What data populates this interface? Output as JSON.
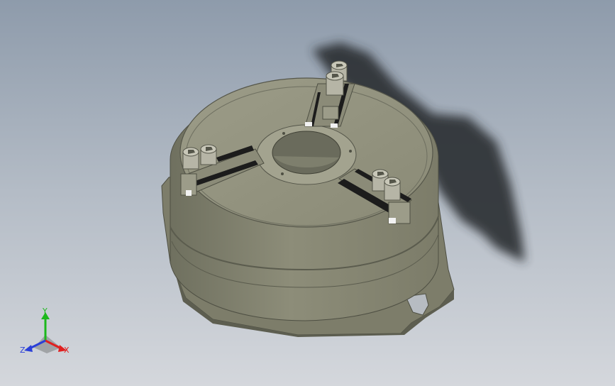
{
  "viewport": {
    "model": "chuck-assembly",
    "colors": {
      "background_top": "#8e9bab",
      "background_bottom": "#d4d7dc",
      "body": "#8c8c78",
      "body_dark": "#6f705f",
      "body_light": "#a3a38f",
      "shadow": "#2b2d30",
      "jaw_slot": "#1c1c1c",
      "bolt": "#b6b5a6"
    }
  },
  "triad": {
    "y_label": "Y",
    "x_label": "X",
    "z_label": "Z",
    "colors": {
      "x": "#e02020",
      "y": "#1cb81c",
      "z": "#2a3fd8"
    }
  }
}
